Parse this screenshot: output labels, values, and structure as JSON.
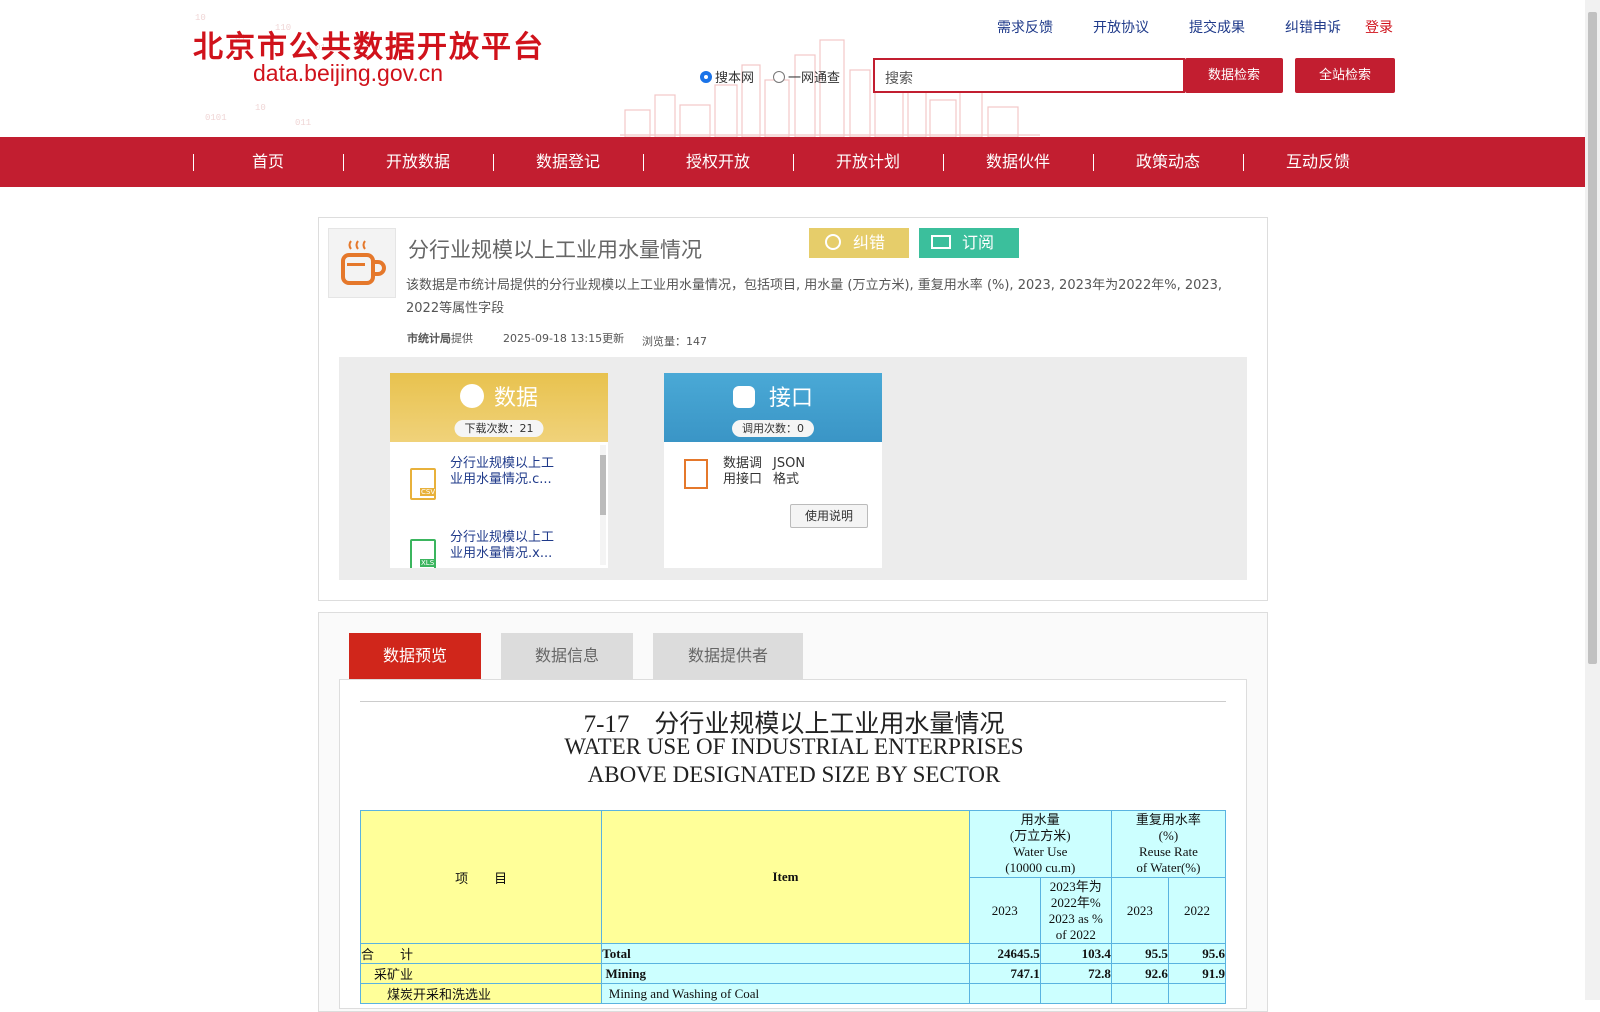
{
  "site": {
    "title_cn": "北京市公共数据开放平台",
    "domain": "data.beijing.gov.cn"
  },
  "toplinks": [
    "需求反馈",
    "开放协议",
    "提交成果",
    "纠错申诉"
  ],
  "login": "登录",
  "search": {
    "scope_local": "搜本网",
    "scope_all": "一网通查",
    "placeholder": "搜索",
    "btn_data": "数据检索",
    "btn_site": "全站检索"
  },
  "nav": [
    "首页",
    "开放数据",
    "数据登记",
    "授权开放",
    "开放计划",
    "数据伙伴",
    "政策动态",
    "互动反馈"
  ],
  "dataset": {
    "title": "分行业规模以上工业用水量情况",
    "btn_error": "纠错",
    "btn_subscribe": "订阅",
    "description": "该数据是市统计局提供的分行业规模以上工业用水量情况，包括项目, 用水量 (万立方米), 重复用水率 (%), 2023, 2023年为2022年%, 2023, 2022等属性字段",
    "provider": "市统计局",
    "provider_suffix": "提供",
    "updated": "2025-09-18 13:15更新",
    "views_label": "浏览量：",
    "views": "147"
  },
  "data_card": {
    "title": "数据",
    "download_label": "下载次数：21",
    "files": [
      "分行业规模以上工业用水量情况.c...",
      "分行业规模以上工业用水量情况.x..."
    ],
    "file_types": [
      "CSV",
      "XLS"
    ]
  },
  "api_card": {
    "title": "接口",
    "call_label": "调用次数：0",
    "api_label": "数据调用接口",
    "format_label": "JSON格式",
    "usage_btn": "使用说明"
  },
  "tabs": [
    "数据预览",
    "数据信息",
    "数据提供者"
  ],
  "preview": {
    "title_cn": "7-17　分行业规模以上工业用水量情况",
    "title_en1": "WATER USE OF INDUSTRIAL ENTERPRISES",
    "title_en2": "ABOVE DESIGNATED SIZE BY SECTOR",
    "header": {
      "item_cn": "项　　目",
      "item_en": "Item",
      "water_use": "用水量\n(万立方米)\nWater Use\n(10000 cu.m)",
      "reuse": "重复用水率\n(%)\nReuse Rate\nof Water(%)",
      "y2023": "2023",
      "pct": "2023年为\n2022年%\n2023 as %\nof 2022",
      "r2023": "2023",
      "r2022": "2022"
    },
    "rows": [
      {
        "cn": "合　　计",
        "en": "Total",
        "v1": "24645.5",
        "v2": "103.4",
        "v3": "95.5",
        "v4": "95.6"
      },
      {
        "cn": "　采矿业",
        "en": " Mining",
        "v1": "747.1",
        "v2": "72.8",
        "v3": "92.6",
        "v4": "91.9"
      },
      {
        "cn": "　　煤炭开采和洗选业",
        "en": "  Mining and Washing of Coal",
        "v1": "",
        "v2": "",
        "v3": "",
        "v4": ""
      }
    ]
  }
}
